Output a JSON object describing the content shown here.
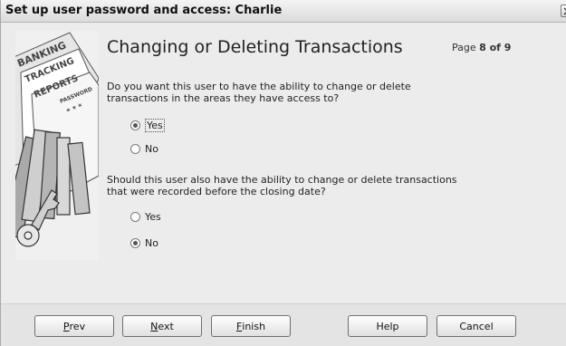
{
  "window": {
    "title": "Set up user password and access: Charlie"
  },
  "illustration": {
    "words": [
      "BANKING",
      "TRACKING",
      "REPORTS",
      "PASSWORD",
      "* * *"
    ]
  },
  "header": {
    "heading": "Changing or Deleting Transactions",
    "page_prefix": "Page",
    "page_current": "8 of 9"
  },
  "question1": {
    "text": "Do you want this user to have the ability to change or delete transactions in the areas they have access to?",
    "options": [
      {
        "label": "Yes",
        "selected": true
      },
      {
        "label": "No",
        "selected": false
      }
    ]
  },
  "question2": {
    "text": "Should this user also have the ability to change or delete transactions that were recorded before the closing date?",
    "options": [
      {
        "label": "Yes",
        "selected": false
      },
      {
        "label": "No",
        "selected": true
      }
    ]
  },
  "buttons": {
    "prev": {
      "mnemonic": "P",
      "rest": "rev"
    },
    "next": {
      "mnemonic": "N",
      "rest": "ext"
    },
    "finish": {
      "mnemonic": "F",
      "rest": "inish"
    },
    "help": "Help",
    "cancel": "Cancel"
  }
}
